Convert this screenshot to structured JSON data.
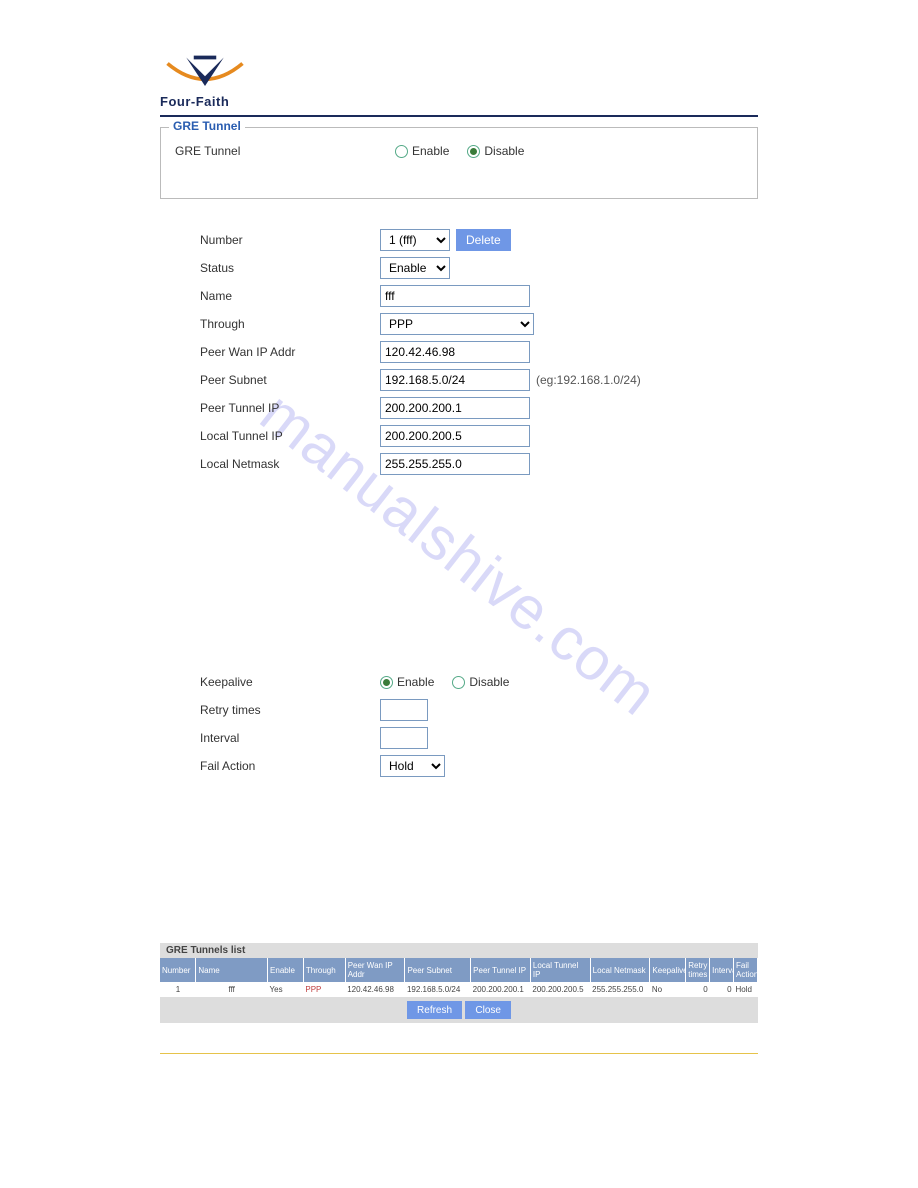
{
  "brand": {
    "company": "Four-Faith"
  },
  "watermark": "manualshive.com",
  "gre_box": {
    "legend": "GRE Tunnel",
    "label": "GRE Tunnel",
    "enable": "Enable",
    "disable": "Disable"
  },
  "form": {
    "number": {
      "label": "Number",
      "value": "1 (fff)",
      "delete": "Delete"
    },
    "status": {
      "label": "Status",
      "value": "Enable"
    },
    "name": {
      "label": "Name",
      "value": "fff"
    },
    "through": {
      "label": "Through",
      "value": "PPP"
    },
    "peer_wan": {
      "label": "Peer Wan IP Addr",
      "value": "120.42.46.98"
    },
    "peer_subnet": {
      "label": "Peer Subnet",
      "value": "192.168.5.0/24",
      "hint": "(eg:192.168.1.0/24)"
    },
    "peer_tunnel": {
      "label": "Peer Tunnel IP",
      "value": "200.200.200.1"
    },
    "local_tunnel": {
      "label": "Local Tunnel IP",
      "value": "200.200.200.5"
    },
    "local_netmask": {
      "label": "Local Netmask",
      "value": "255.255.255.0"
    }
  },
  "keepalive": {
    "label": "Keepalive",
    "enable": "Enable",
    "disable": "Disable",
    "retry_label": "Retry times",
    "retry_value": "",
    "interval_label": "Interval",
    "interval_value": "",
    "fail_label": "Fail Action",
    "fail_value": "Hold"
  },
  "table": {
    "title": "GRE Tunnels list",
    "headers": [
      "Number",
      "Name",
      "Enable",
      "Through",
      "Peer Wan IP Addr",
      "Peer Subnet",
      "Peer Tunnel IP",
      "Local Tunnel IP",
      "Local Netmask",
      "Keepalive",
      "Retry times",
      "Interval",
      "Fail Action"
    ],
    "row": [
      "1",
      "fff",
      "Yes",
      "PPP",
      "120.42.46.98",
      "192.168.5.0/24",
      "200.200.200.1",
      "200.200.200.5",
      "255.255.255.0",
      "No",
      "0",
      "0",
      "Hold"
    ],
    "refresh": "Refresh",
    "close": "Close"
  }
}
